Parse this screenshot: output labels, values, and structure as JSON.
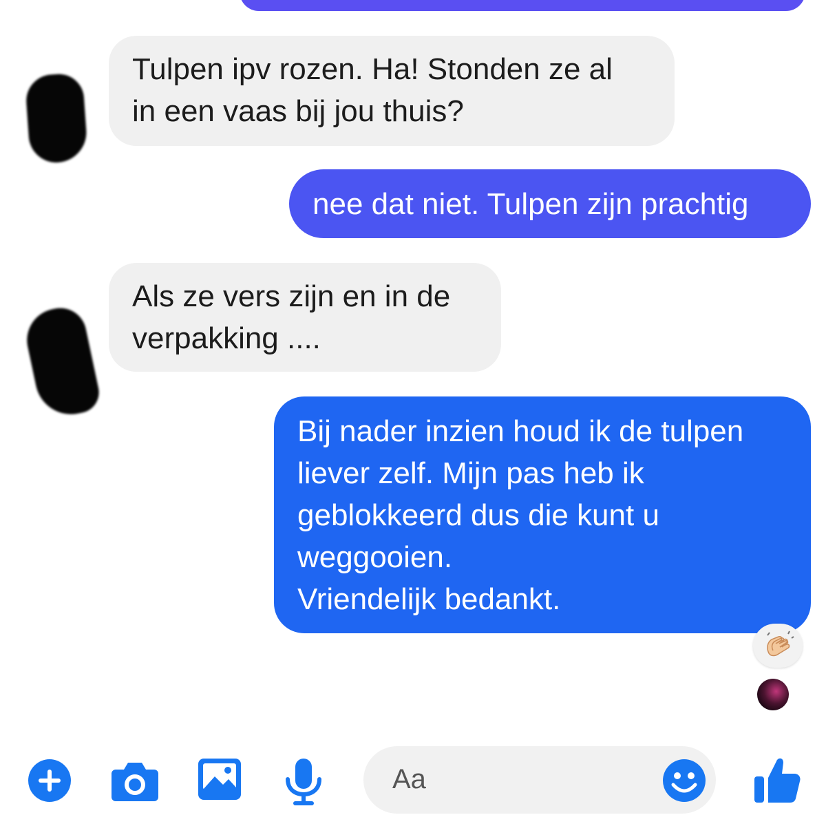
{
  "conversation": {
    "messages": [
      {
        "direction": "incoming",
        "text": "Tulpen ipv rozen. Ha! Stonden ze al\nin een vaas bij jou thuis?"
      },
      {
        "direction": "outgoing",
        "text": "nee dat niet. Tulpen zijn prachtig"
      },
      {
        "direction": "incoming",
        "text": "Als ze vers zijn en in de\nverpakking ...."
      },
      {
        "direction": "outgoing",
        "text": "Bij nader inzien houd ik de tulpen\nliever zelf. Mijn pas heb ik\ngeblokkeerd dus die kunt u\nweggooien.\nVriendelijk bedankt."
      }
    ],
    "reaction": {
      "icon": "clapping-hands-icon"
    },
    "read_receipt": {
      "icon": "avatar"
    }
  },
  "composer": {
    "placeholder": "Aa",
    "buttons": [
      "plus-icon",
      "camera-icon",
      "image-icon",
      "microphone-icon",
      "emoji-icon",
      "thumbs-up-icon"
    ]
  },
  "colors": {
    "outgoing_bubble": "#1f66f2",
    "outgoing_bubble_alt": "#4b55f2",
    "incoming_bubble": "#f0f0f0",
    "accent": "#1877f2"
  }
}
